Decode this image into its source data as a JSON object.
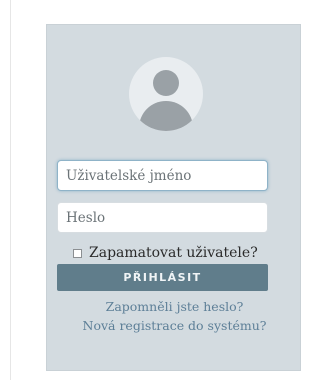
{
  "login": {
    "username_placeholder": "Uživatelské jméno",
    "password_placeholder": "Heslo",
    "remember_label": "Zapamatovat uživatele?",
    "remember_checked": false,
    "submit_label": "PŘIHLÁSIT",
    "forgot_password_link": "Zapomněli jste heslo?",
    "register_link": "Nová registrace do systému?"
  },
  "colors": {
    "card_background": "#d3dbe0",
    "button_background": "#607d8b",
    "link_color": "#5d7f97"
  },
  "icons": {
    "avatar": "user-placeholder-icon"
  }
}
